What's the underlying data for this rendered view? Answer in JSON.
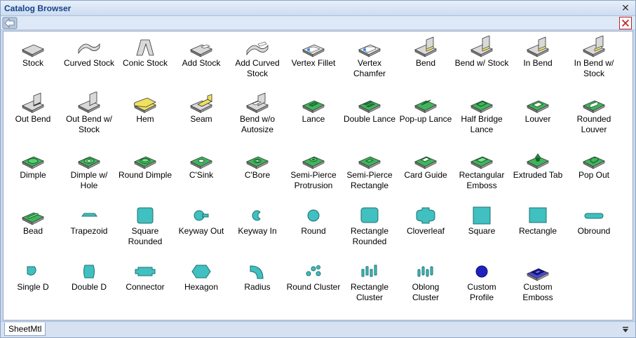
{
  "window": {
    "title": "Catalog Browser",
    "tab": "SheetMtl"
  },
  "icons": {
    "close": "close-icon",
    "back": "back-arrow-icon",
    "panel_close": "red-close-icon",
    "menu": "dropdown-triangle-icon"
  },
  "colors": {
    "accent_title": "#15428b",
    "feature_green": "#3fb55b",
    "plate_gray": "#d9d9d9",
    "hem_yellow": "#f0e060",
    "punch_cyan": "#40c0c0",
    "profile_blue": "#2020c0"
  },
  "items": [
    {
      "label": "Stock",
      "icon": "stock-plate"
    },
    {
      "label": "Curved Stock",
      "icon": "curved-stock"
    },
    {
      "label": "Conic Stock",
      "icon": "conic-stock"
    },
    {
      "label": "Add Stock",
      "icon": "add-stock"
    },
    {
      "label": "Add Curved\nStock",
      "icon": "add-curved-stock"
    },
    {
      "label": "Vertex Fillet",
      "icon": "vertex-fillet"
    },
    {
      "label": "Vertex\nChamfer",
      "icon": "vertex-chamfer"
    },
    {
      "label": "Bend",
      "icon": "bend"
    },
    {
      "label": "Bend w/ Stock",
      "icon": "bend-with-stock"
    },
    {
      "label": "In Bend",
      "icon": "in-bend"
    },
    {
      "label": "In Bend w/\nStock",
      "icon": "in-bend-with-stock"
    },
    {
      "label": "Out Bend",
      "icon": "out-bend"
    },
    {
      "label": "Out Bend w/\nStock",
      "icon": "out-bend-with-stock"
    },
    {
      "label": "Hem",
      "icon": "hem"
    },
    {
      "label": "Seam",
      "icon": "seam"
    },
    {
      "label": "Bend w/o\nAutosize",
      "icon": "bend-no-autosize"
    },
    {
      "label": "Lance",
      "icon": "lance"
    },
    {
      "label": "Double Lance",
      "icon": "double-lance"
    },
    {
      "label": "Pop-up Lance",
      "icon": "popup-lance"
    },
    {
      "label": "Half Bridge\nLance",
      "icon": "half-bridge-lance"
    },
    {
      "label": "Louver",
      "icon": "louver"
    },
    {
      "label": "Rounded\nLouver",
      "icon": "rounded-louver"
    },
    {
      "label": "Dimple",
      "icon": "dimple"
    },
    {
      "label": "Dimple w/\nHole",
      "icon": "dimple-hole"
    },
    {
      "label": "Round Dimple",
      "icon": "round-dimple"
    },
    {
      "label": "C'Sink",
      "icon": "csink"
    },
    {
      "label": "C'Bore",
      "icon": "cbore"
    },
    {
      "label": "Semi-Pierce\nProtrusion",
      "icon": "semi-pierce-protrusion"
    },
    {
      "label": "Semi-Pierce\nRectangle",
      "icon": "semi-pierce-rectangle"
    },
    {
      "label": "Card Guide",
      "icon": "card-guide"
    },
    {
      "label": "Rectangular\nEmboss",
      "icon": "rectangular-emboss"
    },
    {
      "label": "Extruded Tab",
      "icon": "extruded-tab"
    },
    {
      "label": "Pop Out",
      "icon": "pop-out"
    },
    {
      "label": "Bead",
      "icon": "bead"
    },
    {
      "label": "Trapezoid",
      "icon": "trapezoid"
    },
    {
      "label": "Square\nRounded",
      "icon": "square-rounded"
    },
    {
      "label": "Keyway Out",
      "icon": "keyway-out"
    },
    {
      "label": "Keyway In",
      "icon": "keyway-in"
    },
    {
      "label": "Round",
      "icon": "round"
    },
    {
      "label": "Rectangle\nRounded",
      "icon": "rectangle-rounded"
    },
    {
      "label": "Cloverleaf",
      "icon": "cloverleaf"
    },
    {
      "label": "Square",
      "icon": "square"
    },
    {
      "label": "Rectangle",
      "icon": "rectangle"
    },
    {
      "label": "Obround",
      "icon": "obround"
    },
    {
      "label": "Single D",
      "icon": "single-d"
    },
    {
      "label": "Double D",
      "icon": "double-d"
    },
    {
      "label": "Connector",
      "icon": "connector"
    },
    {
      "label": "Hexagon",
      "icon": "hexagon"
    },
    {
      "label": "Radius",
      "icon": "radius"
    },
    {
      "label": "Round Cluster",
      "icon": "round-cluster"
    },
    {
      "label": "Rectangle\nCluster",
      "icon": "rectangle-cluster"
    },
    {
      "label": "Oblong\nCluster",
      "icon": "oblong-cluster"
    },
    {
      "label": "Custom\nProfile",
      "icon": "custom-profile"
    },
    {
      "label": "Custom\nEmboss",
      "icon": "custom-emboss"
    }
  ]
}
